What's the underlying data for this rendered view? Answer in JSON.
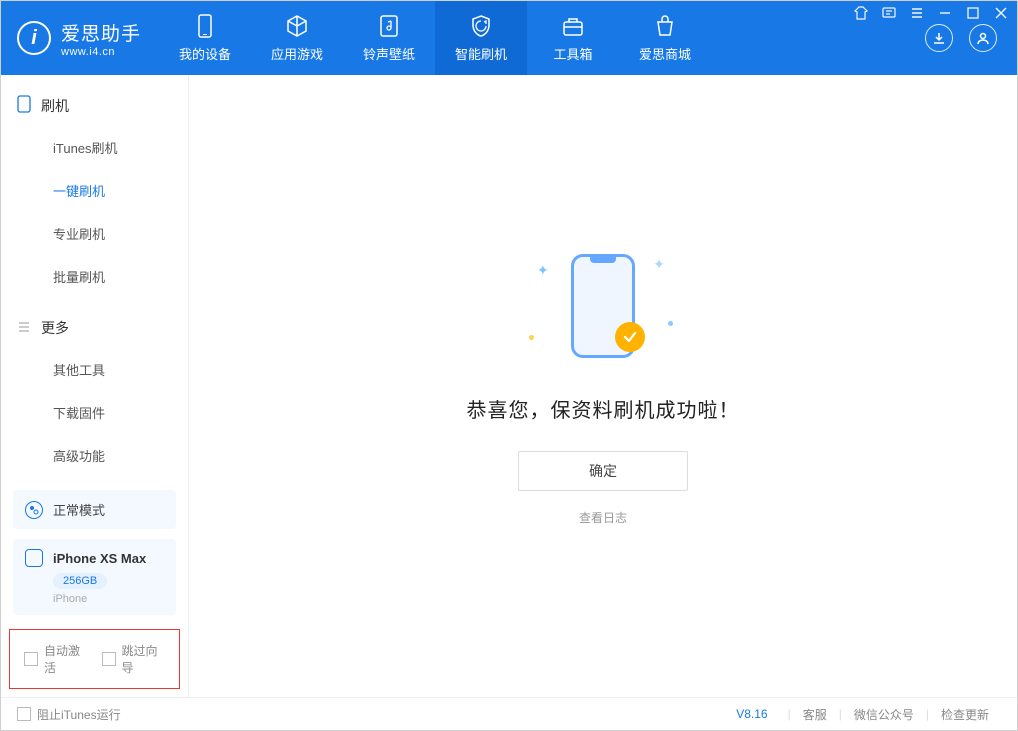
{
  "app": {
    "title": "爱思助手",
    "url": "www.i4.cn"
  },
  "header_tabs": [
    {
      "label": "我的设备",
      "icon": "device-icon"
    },
    {
      "label": "应用游戏",
      "icon": "cube-icon"
    },
    {
      "label": "铃声壁纸",
      "icon": "music-icon"
    },
    {
      "label": "智能刷机",
      "icon": "shield-icon",
      "active": true
    },
    {
      "label": "工具箱",
      "icon": "toolbox-icon"
    },
    {
      "label": "爱思商城",
      "icon": "shop-icon"
    }
  ],
  "sidebar": {
    "section1": {
      "title": "刷机",
      "items": [
        {
          "label": "iTunes刷机"
        },
        {
          "label": "一键刷机",
          "active": true
        },
        {
          "label": "专业刷机"
        },
        {
          "label": "批量刷机"
        }
      ]
    },
    "section2": {
      "title": "更多",
      "items": [
        {
          "label": "其他工具"
        },
        {
          "label": "下载固件"
        },
        {
          "label": "高级功能"
        }
      ]
    },
    "mode": {
      "label": "正常模式"
    },
    "device": {
      "name": "iPhone XS Max",
      "capacity": "256GB",
      "type": "iPhone"
    },
    "bottom_options": {
      "auto_activate": "自动激活",
      "skip_guide": "跳过向导"
    }
  },
  "main": {
    "success_title": "恭喜您，保资料刷机成功啦！",
    "confirm_label": "确定",
    "view_log_label": "查看日志"
  },
  "footer": {
    "block_itunes": "阻止iTunes运行",
    "version": "V8.16",
    "links": {
      "support": "客服",
      "wechat": "微信公众号",
      "update": "检查更新"
    }
  }
}
